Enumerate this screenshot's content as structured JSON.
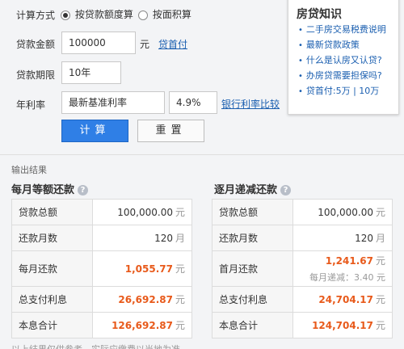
{
  "form": {
    "calc_method_label": "计算方式",
    "method_options": [
      {
        "label": "按贷款额度算",
        "selected": true
      },
      {
        "label": "按面积算",
        "selected": false
      }
    ],
    "loan_amount_label": "贷款金额",
    "loan_amount_value": "100000",
    "loan_amount_unit": "元",
    "down_payment_link": "贷首付",
    "loan_term_label": "贷款期限",
    "loan_term_value": "10年",
    "rate_label": "年利率",
    "rate_type_value": "最新基准利率",
    "rate_value": "4.9%",
    "bank_rate_link": "银行利率比较",
    "calc_button": "计算",
    "reset_button": "重置"
  },
  "knowledge": {
    "title": "房贷知识",
    "items": [
      "二手房交易税费说明",
      "最新贷款政策",
      "什么是认房又认贷?",
      "办房贷需要担保吗?",
      "贷首付:5万 | 10万"
    ]
  },
  "results": {
    "output_label": "输出结果",
    "left": {
      "title": "每月等额还款",
      "rows": [
        {
          "key": "贷款总额",
          "value": "100,000.00",
          "unit": "元",
          "highlight": false
        },
        {
          "key": "还款月数",
          "value": "120",
          "unit": "月",
          "highlight": false
        },
        {
          "key": "每月还款",
          "value": "1,055.77",
          "unit": "元",
          "highlight": true
        },
        {
          "key": "总支付利息",
          "value": "26,692.87",
          "unit": "元",
          "highlight": true
        },
        {
          "key": "本息合计",
          "value": "126,692.87",
          "unit": "元",
          "highlight": true
        }
      ]
    },
    "right": {
      "title": "逐月递减还款",
      "rows": [
        {
          "key": "贷款总额",
          "value": "100,000.00",
          "unit": "元",
          "highlight": false
        },
        {
          "key": "还款月数",
          "value": "120",
          "unit": "月",
          "highlight": false
        },
        {
          "key": "首月还款",
          "value": "1,241.67",
          "unit": "元",
          "highlight": true,
          "sub": "每月递减：3.40 元"
        },
        {
          "key": "总支付利息",
          "value": "24,704.17",
          "unit": "元",
          "highlight": true
        },
        {
          "key": "本息合计",
          "value": "124,704.17",
          "unit": "元",
          "highlight": true
        }
      ]
    }
  },
  "footer": "以上结果仅供参考，实际应缴费以当地为准"
}
